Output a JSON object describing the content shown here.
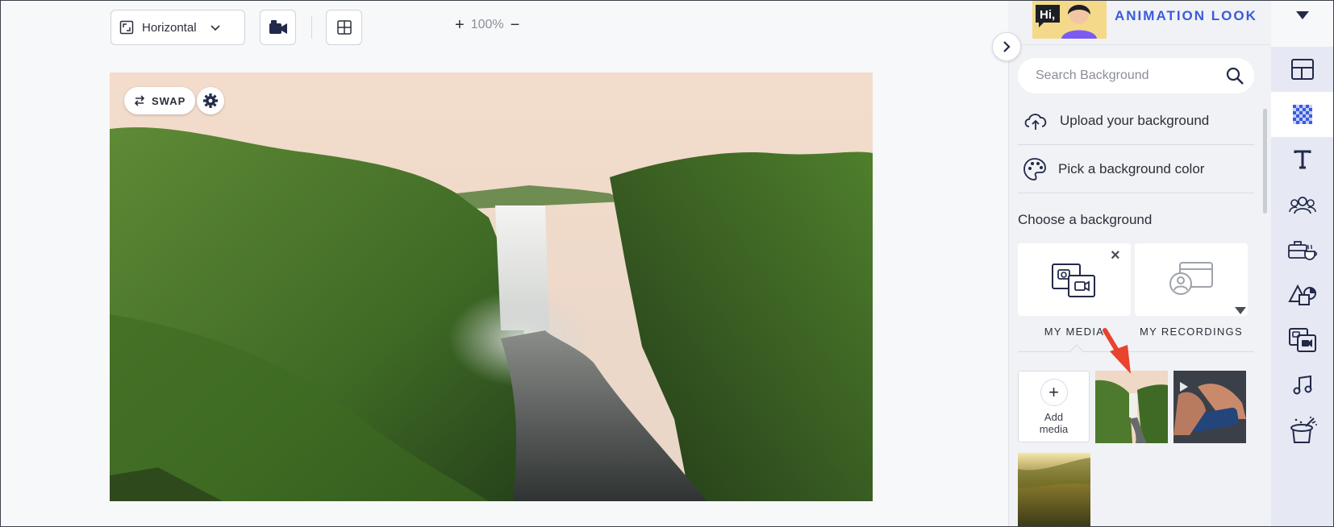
{
  "toolbar": {
    "orientation_label": "Horizontal",
    "zoom_level": "100%",
    "zoom_in": "+",
    "zoom_out": "−"
  },
  "canvas": {
    "swap_label": "SWAP"
  },
  "panel": {
    "look_title": "ANIMATION LOOK",
    "avatar_text": "Hi,",
    "search_placeholder": "Search Background",
    "upload_label": "Upload your background",
    "pick_color_label": "Pick a background color",
    "choose_heading": "Choose a background",
    "tiles": [
      {
        "label": "MY MEDIA"
      },
      {
        "label": "MY RECORDINGS"
      }
    ],
    "close_symbol": "×",
    "add_media_label": "Add media",
    "add_symbol": "+"
  },
  "sidebar_icons": [
    "layout-icon",
    "background-icon",
    "text-icon",
    "characters-icon",
    "props-icon",
    "shapes-icon",
    "media-icon",
    "music-icon",
    "effects-icon"
  ],
  "colors": {
    "accent": "#3a5bdb",
    "arrow": "#e8432f",
    "panel_bg": "#f1f2f5",
    "iconbar_bg": "#e6e9f3"
  }
}
